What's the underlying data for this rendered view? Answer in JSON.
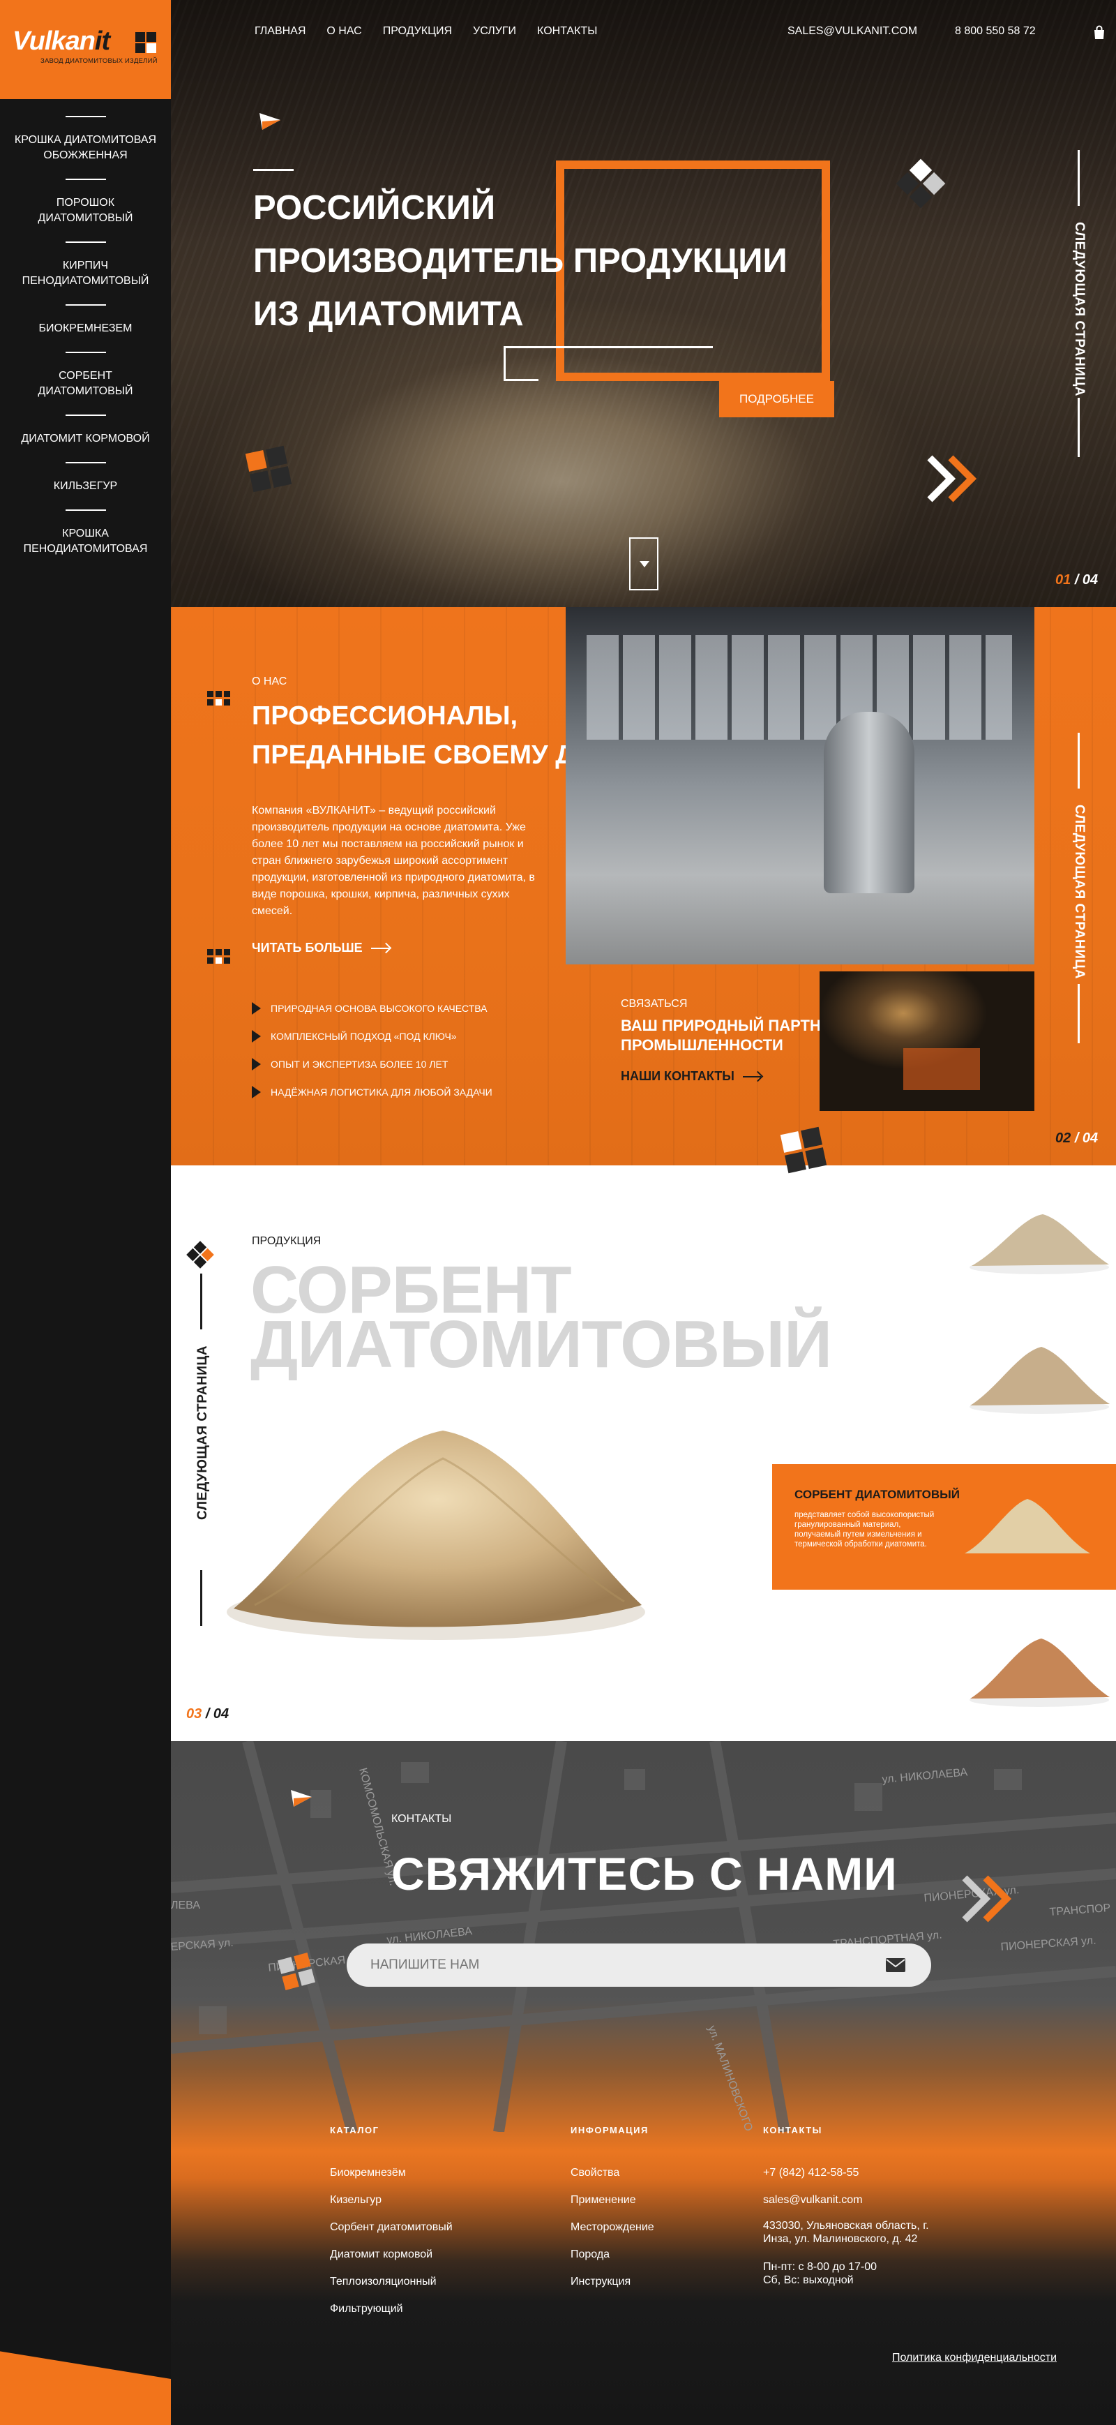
{
  "brand": {
    "name_part1": "Vulkan",
    "name_part2": "it",
    "subtitle": "ЗАВОД ДИАТОМИТОВЫХ ИЗДЕЛИЙ",
    "accent": "#f2741b",
    "dark": "#161616"
  },
  "sidebar": {
    "items": [
      {
        "label": "КРОШКА ДИАТОМИТОВАЯ\nОБОЖЖЕННАЯ"
      },
      {
        "label": "ПОРОШОК\nДИАТОМИТОВЫЙ"
      },
      {
        "label": "КИРПИЧ\nПЕНОДИАТОМИТОВЫЙ"
      },
      {
        "label": "БИОКРЕМНЕЗЕМ"
      },
      {
        "label": "СОРБЕНТ\nДИАТОМИТОВЫЙ"
      },
      {
        "label": "ДИАТОМИТ КОРМОВОЙ"
      },
      {
        "label": "КИЛЬЗЕГУР"
      },
      {
        "label": "КРОШКА\nПЕНОДИАТОМИТОВАЯ"
      }
    ]
  },
  "topnav": {
    "items": [
      "ГЛАВНАЯ",
      "О НАС",
      "ПРОДУКЦИЯ",
      "УСЛУГИ",
      "КОНТАКТЫ"
    ],
    "email": "SALES@VULKANIT.COM",
    "phone": "8 800 550 58 72"
  },
  "hero": {
    "title": "РОССИЙСКИЙ\nПРОИЗВОДИТЕЛЬ ПРОДУКЦИИ\nИЗ ДИАТОМИТА",
    "button": "ПОДРОБНЕЕ",
    "next_page": "СЛЕДУЮЩАЯ СТРАНИЦА",
    "pager_current": "01",
    "pager_total": "/ 04"
  },
  "about": {
    "kicker": "О НАС",
    "title": "ПРОФЕССИОНАЛЫ,\nПРЕДАННЫЕ СВОЕМУ ДЕЛУ",
    "text": "Компания «ВУЛКАНИТ» – ведущий российский производитель продукции на основе диатомита. Уже более 10 лет мы поставляем на российский рынок и стран ближнего зарубежья широкий ассортимент продукции, изготовленной из природного диатомита, в виде порошка, крошки, кирпича, различных сухих смесей.",
    "read_more": "ЧИТАТЬ БОЛЬШЕ",
    "facts": [
      "ПРИРОДНАЯ ОСНОВА ВЫСОКОГО КАЧЕСТВА",
      "КОМПЛЕКСНЫЙ ПОДХОД «ПОД КЛЮЧ»",
      "ОПЫТ И ЭКСПЕРТИЗА БОЛЕЕ 10 ЛЕТ",
      "НАДЁЖНАЯ ЛОГИСТИКА ДЛЯ ЛЮБОЙ ЗАДАЧИ"
    ],
    "contact_kicker": "СВЯЗАТЬСЯ",
    "contact_title": "ВАШ ПРИРОДНЫЙ ПАРТНЁР В ПРОМЫШЛЕННОСТИ",
    "contacts_link": "НАШИ КОНТАКТЫ",
    "next_page": "СЛЕДУЮЩАЯ СТРАНИЦА",
    "pager_current": "02",
    "pager_total": "/ 04"
  },
  "products": {
    "kicker": "ПРОДУКЦИЯ",
    "big_title": "СОРБЕНТ\nДИАТОМИТОВЫЙ",
    "card_title": "СОРБЕНТ ДИАТОМИТОВЫЙ",
    "card_text": "представляет собой высокопористый гранулированный материал, получаемый путем измельчения и термической обработки диатомита.",
    "next_page": "СЛЕДУЮЩАЯ СТРАНИЦА",
    "pager_current": "03",
    "pager_total": "/ 04"
  },
  "contact": {
    "kicker": "КОНТАКТЫ",
    "title": "СВЯЖИТЕСЬ С НАМИ",
    "placeholder": "НАПИШИТЕ НАМ",
    "map_labels": [
      "КОМСОМОЛЬСКАЯ ул.",
      "ул. НИКОЛАЕВА",
      "ПИОНЕРСКАЯ ул.",
      "ТРАНСПОРТНАЯ ул.",
      "ПИОНЕРСКАЯ ул.",
      "ул. НИКОЛАЕВА",
      "ул. МАЛИНОВСКОГО",
      "ЛЕВА",
      "ЕРСКАЯ ул.",
      "ПИОНЕРСКАЯ ул.",
      "ТРАНСПОР"
    ]
  },
  "footer": {
    "catalog_title": "КАТАЛОГ",
    "catalog": [
      "Биокремнезём",
      "Кизельгур",
      "Сорбент диатомитовый",
      "Диатомит кормовой",
      "Теплоизоляционный",
      "Фильтрующий"
    ],
    "info_title": "ИНФОРМАЦИЯ",
    "info": [
      "Свойства",
      "Применение",
      "Месторождение",
      "Порода",
      "Инструкция"
    ],
    "contacts_title": "КОНТАКТЫ",
    "phone": "+7 (842) 412-58-55",
    "email": "sales@vulkanit.com",
    "address": "433030, Ульяновская область, г.\nИнза, ул. Малиновского, д. 42",
    "hours": "Пн-пт: с 8-00 до 17-00\nСб, Вс: выходной",
    "privacy": "Политика конфиденциальности"
  }
}
